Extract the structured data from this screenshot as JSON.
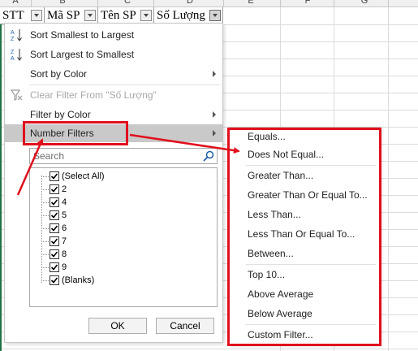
{
  "spreadsheet": {
    "column_letters": [
      "A",
      "B",
      "C",
      "D",
      "E",
      "F",
      "G"
    ],
    "header_cells": [
      "STT",
      "Mã SP",
      "Tên SP",
      "Số Lượng"
    ]
  },
  "filter_menu": {
    "sort_asc": "Sort Smallest to Largest",
    "sort_desc": "Sort Largest to Smallest",
    "sort_by_color": "Sort by Color",
    "clear_filter": "Clear Filter From \"Số Lượng\"",
    "filter_by_color": "Filter by Color",
    "number_filters": "Number Filters",
    "search_placeholder": "Search",
    "list_items": [
      "(Select All)",
      "2",
      "4",
      "5",
      "6",
      "7",
      "8",
      "9",
      "(Blanks)"
    ],
    "ok_label": "OK",
    "cancel_label": "Cancel"
  },
  "number_filters_submenu": {
    "items": [
      "Equals...",
      "Does Not Equal...",
      "Greater Than...",
      "Greater Than Or Equal To...",
      "Less Than...",
      "Less Than Or Equal To...",
      "Between...",
      "Top 10...",
      "Above Average",
      "Below Average",
      "Custom Filter..."
    ]
  },
  "annotation_color": "#e0101d",
  "accent_green": "#217346"
}
